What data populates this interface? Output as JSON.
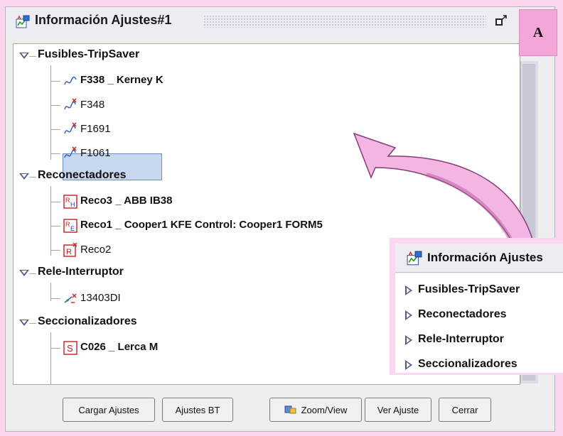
{
  "window": {
    "title": "Información Ajustes#1",
    "label_a": "A"
  },
  "tree": {
    "categories": [
      {
        "label": "Fusibles-TripSaver",
        "items": [
          {
            "label": "F338 _ Kerney  K",
            "bold": true
          },
          {
            "label": "F348",
            "bold": false
          },
          {
            "label": "F1691",
            "bold": false,
            "selected": true
          },
          {
            "label": "F1061",
            "bold": false
          }
        ]
      },
      {
        "label": "Reconectadores",
        "items": [
          {
            "label": "Reco3 _ ABB  IB38",
            "bold": true
          },
          {
            "label": "Reco1 _ Cooper1  KFE   Control: Cooper1  FORM5",
            "bold": true
          },
          {
            "label": "Reco2",
            "bold": false
          }
        ]
      },
      {
        "label": "Rele-Interruptor",
        "items": [
          {
            "label": "13403DI",
            "bold": false
          }
        ]
      },
      {
        "label": "Seccionalizadores",
        "items": [
          {
            "label": "C026 _ Lerca  M",
            "bold": true
          }
        ]
      }
    ]
  },
  "buttons": {
    "cargar": "Cargar Ajustes",
    "ajustes_bt": "Ajustes BT",
    "zoom": "Zoom/View",
    "ver": "Ver Ajuste",
    "cerrar": "Cerrar"
  },
  "popup": {
    "title": "Información Ajustes",
    "items": [
      "Fusibles-TripSaver",
      "Reconectadores",
      "Rele-Interruptor",
      "Seccionalizadores"
    ]
  },
  "colors": {
    "background": "#fbd6ee",
    "selection": "#c8d8ef",
    "arrow": "#f3b5e2"
  }
}
